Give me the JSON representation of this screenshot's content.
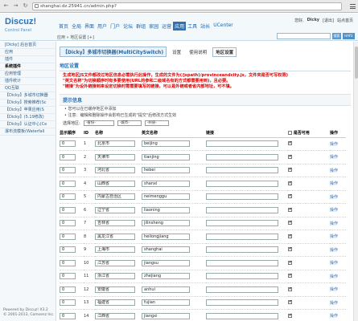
{
  "browser": {
    "url": "shanghai.dz.25941.cn/admin.php?",
    "back_icon": "back-arrow-icon",
    "forward_icon": "forward-arrow-icon",
    "reload_icon": "reload-icon"
  },
  "header": {
    "logo": "Discuz!",
    "logo_sub": "Control Panel",
    "nav": [
      "首页",
      "全局",
      "界面",
      "用户",
      "门户",
      "论坛",
      "群组",
      "家园",
      "运营",
      "应用",
      "工具",
      "站长",
      "UCenter"
    ],
    "active_nav": "应用",
    "greeting": "您好,",
    "user": "Dicky",
    "logout": "[退出]",
    "site_home": "站点首页",
    "breadcrumb": "应用 » 地区设置 [+]",
    "search_btn": "搜索",
    "search_tag": "HAFE"
  },
  "sidebar": {
    "items": [
      "[Dicky] 后台首页",
      "应用",
      "插件",
      "系统插件",
      "应用管理",
      "插件统计",
      "QQ互联",
      "【Dicky】多城市切换器",
      "【Dicky】搜索推荐(Sc",
      "【Dicky】苹果应用(S",
      "【Dicky】(5.19修改)",
      "【Dicky】认证中心(Ce",
      "瀑布流模板(Waterfall"
    ],
    "active_index": 3,
    "footer_line1": "Powered by Discuz! X3.2",
    "footer_line2": "© 2001-2013, Comsenz Inc."
  },
  "main": {
    "plugin_title": "【Dicky】多城市切换器(MultiCitySwitch)",
    "tabs": [
      "设置",
      "使用说明",
      "地区设置"
    ],
    "current_tab": "地区设置",
    "section_title": "地区设置",
    "warnings": [
      "生成地区JS文件都改过地区信息必需执行此操作，生成的文件为(/jspath)/provinceandcity.js，文件夹是否可写权限)",
      "\"英文名称\"为切换顺序时有多要使用(URL的参和二级域名有的方式都需要用到)，且必要。",
      "\"链接\"为设外链接到来设定切换时需需要填写的链接，可以是外链或者省内部地址，可不填。"
    ],
    "tips_title": "提示信息",
    "tips": [
      "您可以在已缓存地区中添加",
      "注意：编辑和删除操作会影响已生成的\"提交\"后修改方式生效"
    ],
    "filter_label": "选择地区:",
    "filter_selects": [
      "-省份-",
      "-城市-",
      "-州县-"
    ],
    "table_headers": {
      "order": "显示顺序",
      "id": "ID",
      "name": "名称",
      "en": "英文名称",
      "link": "链接",
      "enabled": "是否可用",
      "op": "操作"
    },
    "rows": [
      {
        "order": "0",
        "id": "1",
        "name": "北京市",
        "en": "beijing",
        "link": "",
        "enabled": true,
        "op": "操作"
      },
      {
        "order": "0",
        "id": "2",
        "name": "天津市",
        "en": "tianjing",
        "link": "",
        "enabled": true,
        "op": "操作"
      },
      {
        "order": "0",
        "id": "3",
        "name": "河北省",
        "en": "hebei",
        "link": "",
        "enabled": true,
        "op": "操作"
      },
      {
        "order": "0",
        "id": "4",
        "name": "山西省",
        "en": "shanxi",
        "link": "",
        "enabled": true,
        "op": "操作"
      },
      {
        "order": "0",
        "id": "5",
        "name": "内蒙古自治区",
        "en": "neimenggu",
        "link": "",
        "enabled": true,
        "op": "操作"
      },
      {
        "order": "0",
        "id": "6",
        "name": "辽宁省",
        "en": "liaoning",
        "link": "",
        "enabled": true,
        "op": "操作"
      },
      {
        "order": "0",
        "id": "7",
        "name": "吉林省",
        "en": "jilinsheng",
        "link": "",
        "enabled": true,
        "op": "操作"
      },
      {
        "order": "0",
        "id": "8",
        "name": "黑龙江省",
        "en": "heilongjiang",
        "link": "",
        "enabled": true,
        "op": "操作"
      },
      {
        "order": "0",
        "id": "9",
        "name": "上海市",
        "en": "shanghai",
        "link": "",
        "enabled": true,
        "op": "操作"
      },
      {
        "order": "0",
        "id": "10",
        "name": "江苏省",
        "en": "jiangsu",
        "link": "",
        "enabled": true,
        "op": "操作"
      },
      {
        "order": "0",
        "id": "11",
        "name": "浙江省",
        "en": "zhejiang",
        "link": "",
        "enabled": true,
        "op": "操作"
      },
      {
        "order": "0",
        "id": "12",
        "name": "安徽省",
        "en": "anhui",
        "link": "",
        "enabled": true,
        "op": "操作"
      },
      {
        "order": "0",
        "id": "13",
        "name": "福建省",
        "en": "fujian",
        "link": "",
        "enabled": true,
        "op": "操作"
      },
      {
        "order": "0",
        "id": "14",
        "name": "江西省",
        "en": "jiangxi",
        "link": "",
        "enabled": true,
        "op": "操作"
      }
    ]
  }
}
